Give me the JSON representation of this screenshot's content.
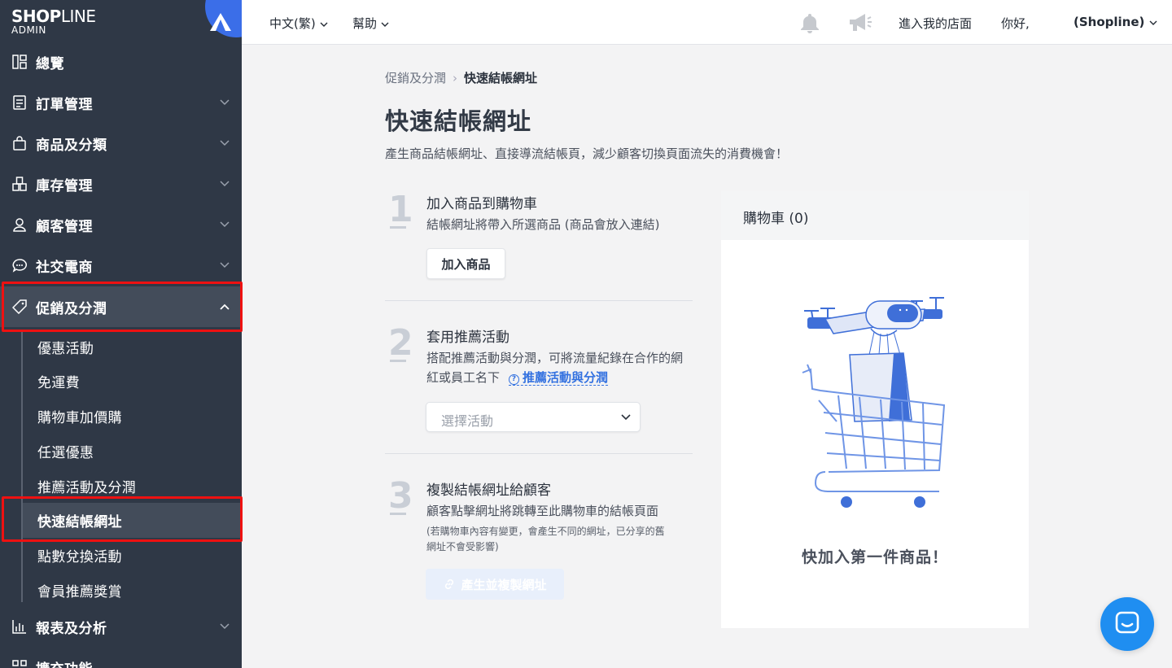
{
  "brand": {
    "logo_strong": "SHOP",
    "logo_light": "LINE",
    "logo_sub": "ADMIN"
  },
  "sidebar": {
    "items": [
      {
        "label": "總覽"
      },
      {
        "label": "訂單管理"
      },
      {
        "label": "商品及分類"
      },
      {
        "label": "庫存管理"
      },
      {
        "label": "顧客管理"
      },
      {
        "label": "社交電商"
      },
      {
        "label": "促銷及分潤"
      },
      {
        "label": "報表及分析"
      },
      {
        "label": "擴充功能"
      }
    ],
    "sub_items": [
      {
        "label": "優惠活動"
      },
      {
        "label": "免運費"
      },
      {
        "label": "購物車加價購"
      },
      {
        "label": "任選優惠"
      },
      {
        "label": "推薦活動及分潤"
      },
      {
        "label": "快速結帳網址"
      },
      {
        "label": "點數兌換活動"
      },
      {
        "label": "會員推薦獎賞"
      }
    ]
  },
  "header": {
    "language": "中文(繁)",
    "help": "幫助",
    "store_link": "進入我的店面",
    "greeting": "你好,",
    "user": "(Shopline)"
  },
  "breadcrumb": {
    "parent": "促銷及分潤",
    "current": "快速結帳網址"
  },
  "page": {
    "title": "快速結帳網址",
    "description": "產生商品結帳網址、直接導流結帳頁，減少顧客切換頁面流失的消費機會！"
  },
  "steps": [
    {
      "num": "1",
      "title": "加入商品到購物車",
      "desc": "結帳網址將帶入所選商品 (商品會放入連結)",
      "button": "加入商品"
    },
    {
      "num": "2",
      "title": "套用推薦活動",
      "desc_line1": "搭配推薦活動與分潤，可將流量紀錄在合作的網",
      "desc_line2": "紅或員工名下",
      "link": "推薦活動與分潤",
      "link_icon": "?",
      "select_placeholder": "選擇活動"
    },
    {
      "num": "3",
      "title": "複製結帳網址給顧客",
      "desc": "顧客點擊網址將跳轉至此購物車的結帳頁面",
      "note_line1": "(若購物車內容有變更，會產生不同的網址，已分享的舊",
      "note_line2": "網址不會受影響)",
      "button": "產生並複製網址"
    }
  ],
  "cart": {
    "title": "購物車 (0)",
    "empty_text": "快加入第一件商品！"
  },
  "colors": {
    "sidebar_bg": "#2f3846",
    "accent": "#3472e0",
    "highlight": "#e11111",
    "chat": "#1f8ef1"
  }
}
